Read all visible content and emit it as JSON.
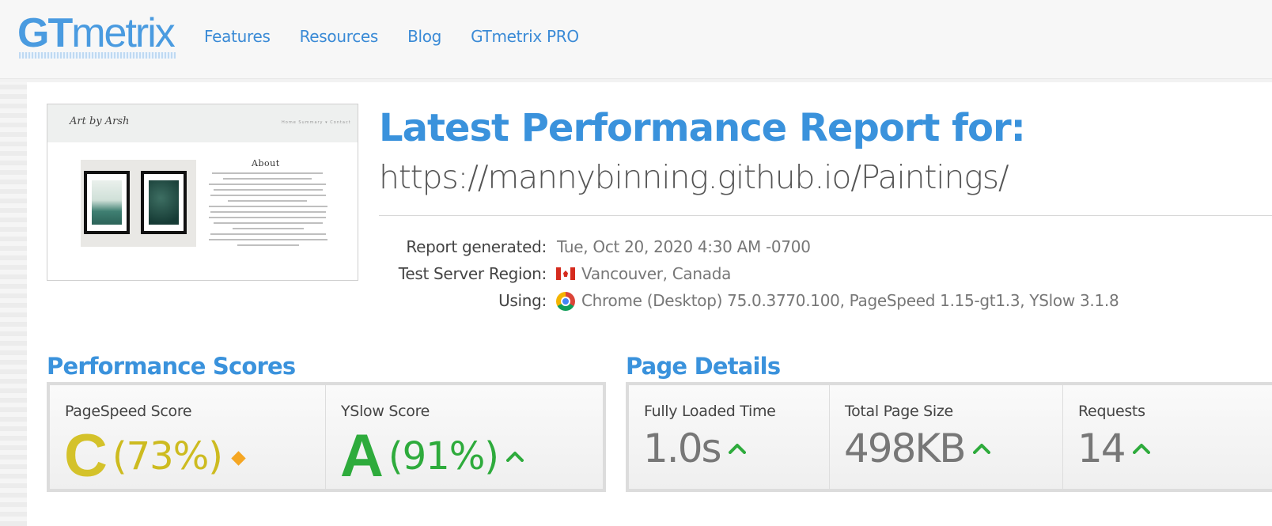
{
  "header": {
    "logo_gt": "GT",
    "logo_metrix": "metrix",
    "nav": [
      "Features",
      "Resources",
      "Blog",
      "GTmetrix PRO"
    ]
  },
  "thumbnail": {
    "brand": "Art by Arsh",
    "nav_text": "Home   Summary ▾   Contact",
    "about_title": "About"
  },
  "report": {
    "title": "Latest Performance Report for:",
    "url": "https://mannybinning.github.io/Paintings/",
    "generated_label": "Report generated:",
    "generated_value": "Tue, Oct 20, 2020 4:30 AM -0700",
    "region_label": "Test Server Region:",
    "region_value": "Vancouver, Canada",
    "using_label": "Using:",
    "using_value": "Chrome (Desktop) 75.0.3770.100, PageSpeed 1.15-gt1.3, YSlow 3.1.8"
  },
  "performance": {
    "heading": "Performance Scores",
    "pagespeed_label": "PageSpeed Score",
    "pagespeed_grade": "C",
    "pagespeed_pct": "(73%)",
    "pagespeed_color": "#d4c22a",
    "yslow_label": "YSlow Score",
    "yslow_grade": "A",
    "yslow_pct": "(91%)",
    "yslow_color": "#2eab3c"
  },
  "details": {
    "heading": "Page Details",
    "loaded_label": "Fully Loaded Time",
    "loaded_value": "1.0s",
    "size_label": "Total Page Size",
    "size_value": "498KB",
    "requests_label": "Requests",
    "requests_value": "14"
  },
  "colors": {
    "accent": "#3a92dc",
    "trend_up": "#2eab3c",
    "trend_neutral": "#f5a623"
  }
}
